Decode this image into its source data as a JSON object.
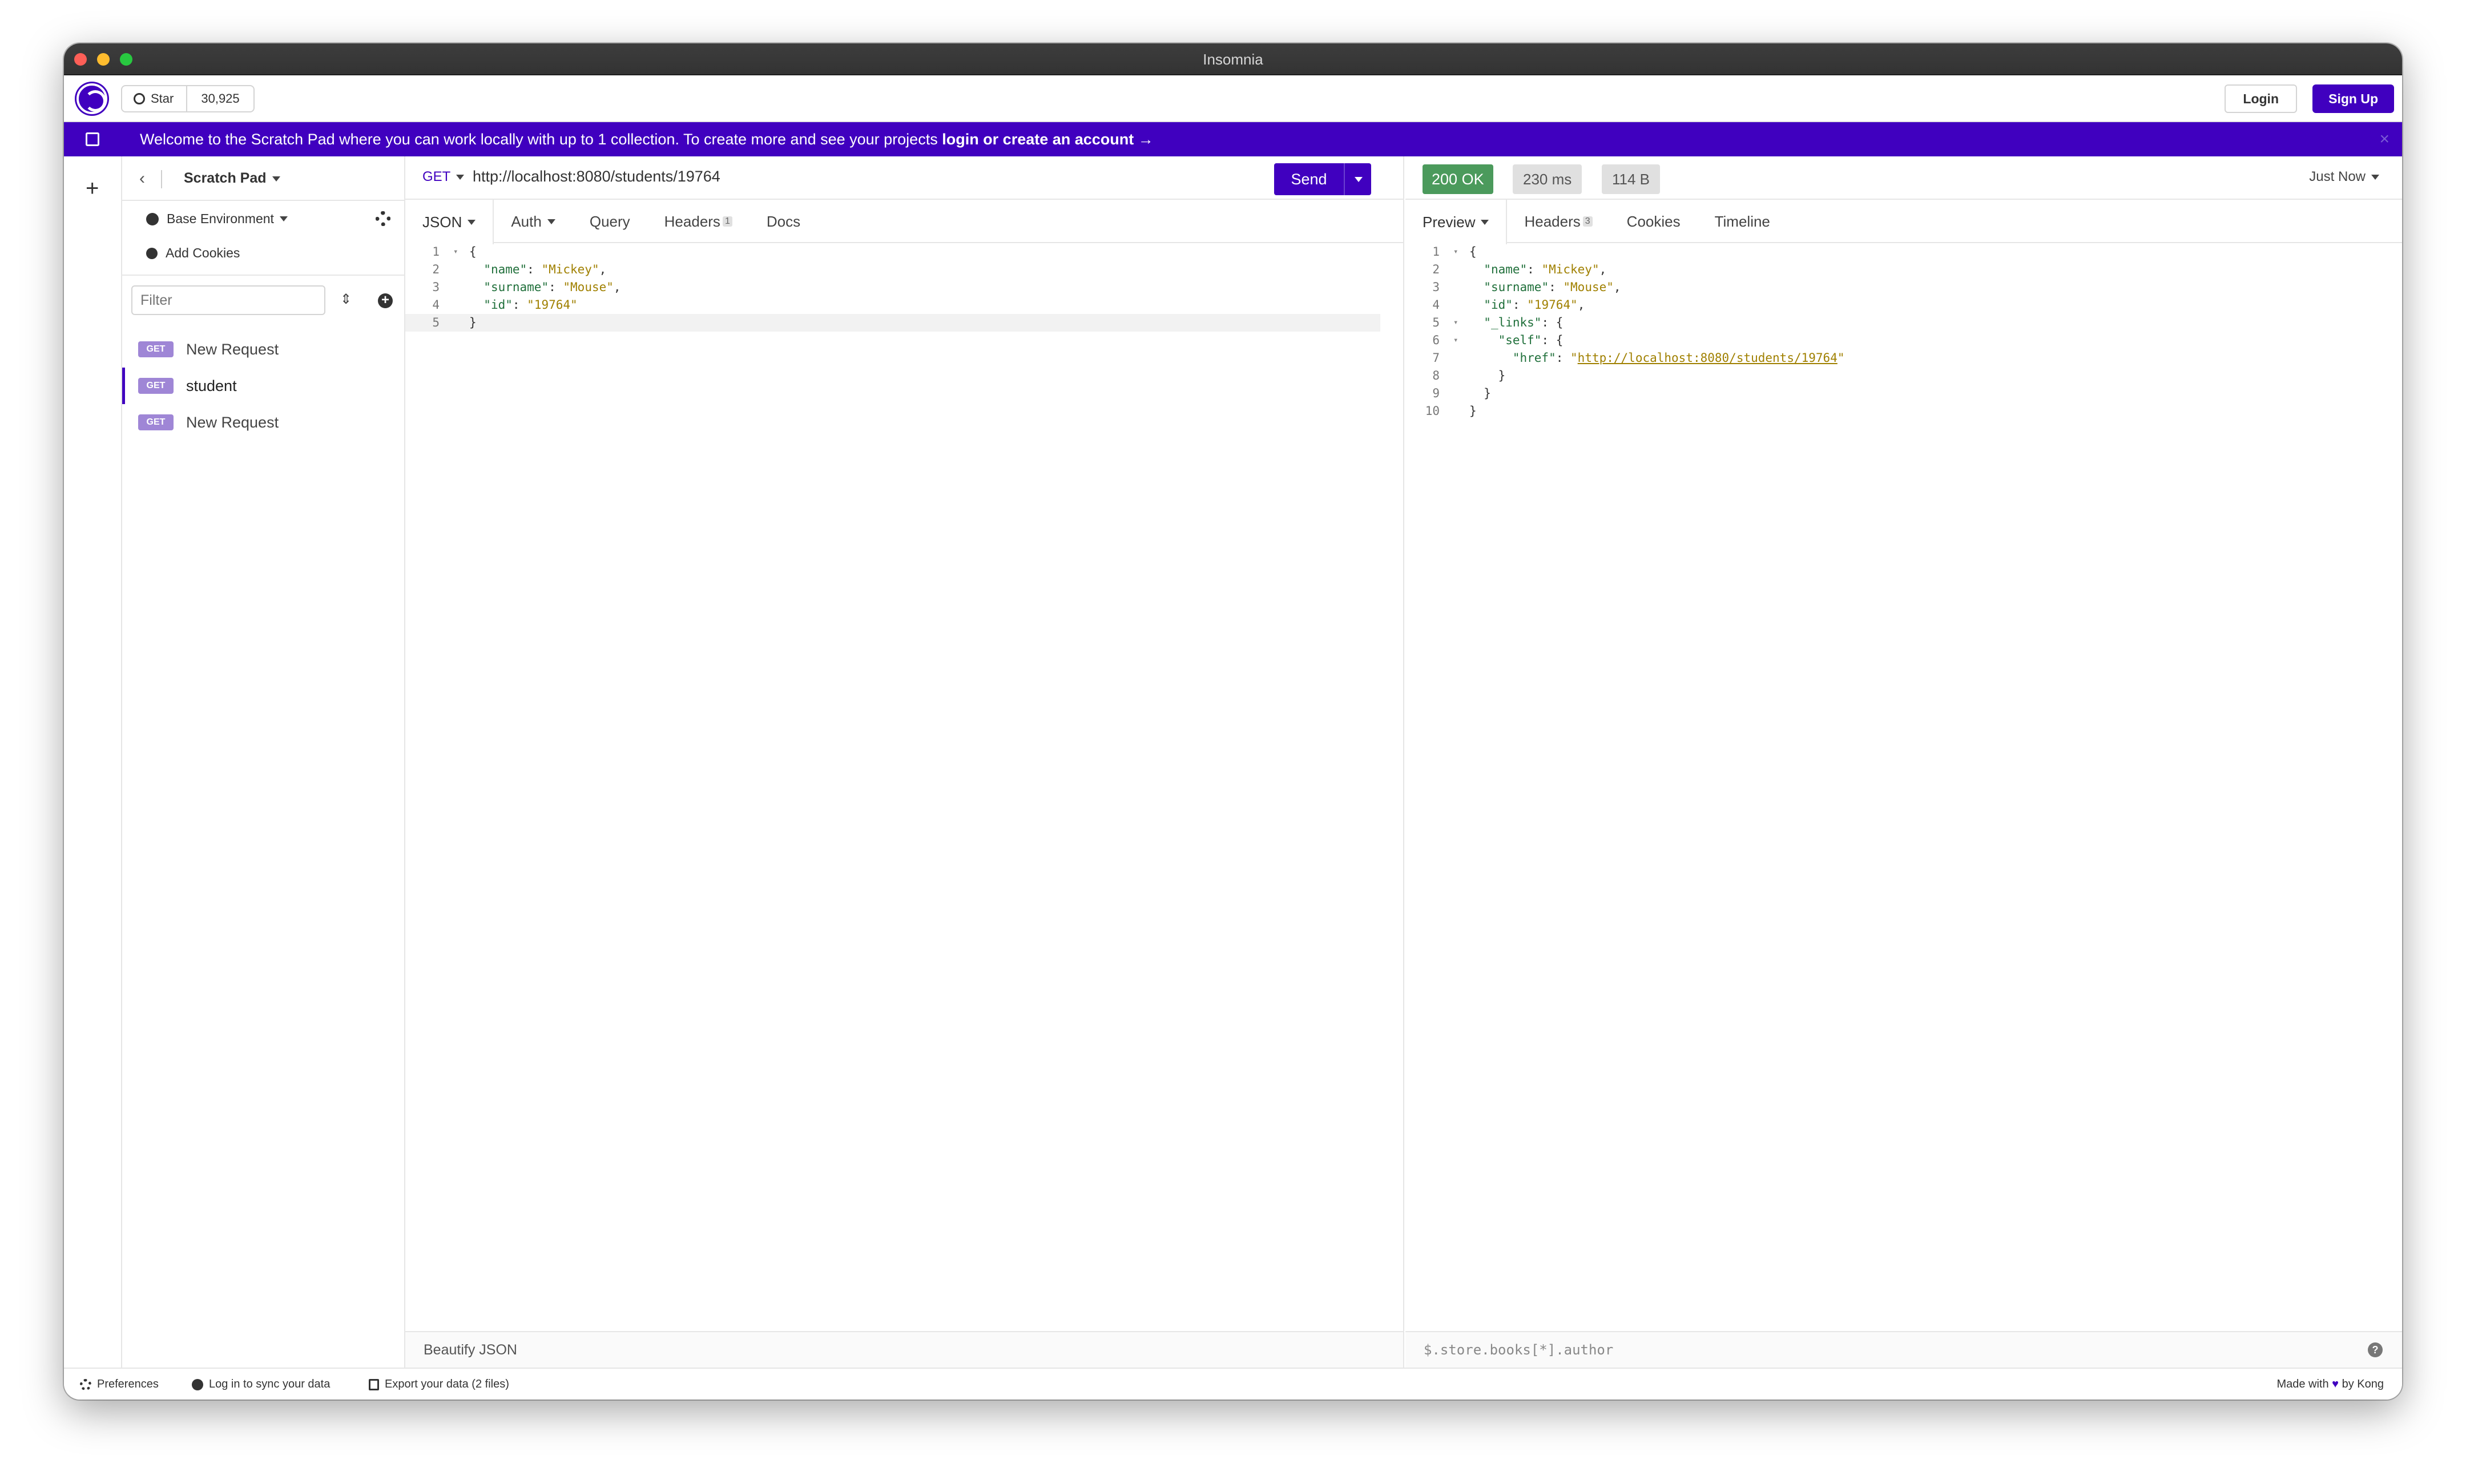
{
  "window": {
    "title": "Insomnia"
  },
  "topbar": {
    "star_label": "Star",
    "star_count": "30,925",
    "login_label": "Login",
    "signup_label": "Sign Up"
  },
  "banner": {
    "text": "Welcome to the Scratch Pad where you can work locally with up to 1 collection. To create more and see your projects ",
    "link": "login or create an account →",
    "close": "×"
  },
  "sidebar": {
    "project": "Scratch Pad",
    "environment": "Base Environment",
    "cookies": "Add Cookies",
    "filter_placeholder": "Filter",
    "requests": [
      {
        "method": "GET",
        "name": "New Request"
      },
      {
        "method": "GET",
        "name": "student"
      },
      {
        "method": "GET",
        "name": "New Request"
      }
    ]
  },
  "request": {
    "method": "GET",
    "url": "http://localhost:8080/students/19764",
    "send_label": "Send",
    "tabs": [
      "JSON",
      "Auth",
      "Query",
      "Headers",
      "Docs"
    ],
    "headers_count": "1",
    "body_lines": [
      {
        "n": "1",
        "fold": true,
        "text": "{"
      },
      {
        "n": "2",
        "key": "\"name\"",
        "val": "\"Mickey\"",
        "end": ","
      },
      {
        "n": "3",
        "key": "\"surname\"",
        "val": "\"Mouse\"",
        "end": ","
      },
      {
        "n": "4",
        "key": "\"id\"",
        "val": "\"19764\"",
        "end": ""
      },
      {
        "n": "5",
        "text": "}"
      }
    ],
    "footer": "Beautify JSON"
  },
  "response": {
    "status_code": "200",
    "status_text": "OK",
    "time": "230 ms",
    "size": "114 B",
    "when": "Just Now",
    "tabs": [
      "Preview",
      "Headers",
      "Cookies",
      "Timeline"
    ],
    "headers_count": "3",
    "body_lines": [
      {
        "n": "1",
        "fold": true,
        "indent": 0,
        "text": "{"
      },
      {
        "n": "2",
        "indent": 1,
        "key": "\"name\"",
        "val": "\"Mickey\"",
        "end": ","
      },
      {
        "n": "3",
        "indent": 1,
        "key": "\"surname\"",
        "val": "\"Mouse\"",
        "end": ","
      },
      {
        "n": "4",
        "indent": 1,
        "key": "\"id\"",
        "val": "\"19764\"",
        "end": ","
      },
      {
        "n": "5",
        "fold": true,
        "indent": 1,
        "key": "\"_links\"",
        "text": "{"
      },
      {
        "n": "6",
        "fold": true,
        "indent": 2,
        "key": "\"self\"",
        "text": "{"
      },
      {
        "n": "7",
        "indent": 3,
        "key": "\"href\"",
        "link": "http://localhost:8080/students/19764"
      },
      {
        "n": "8",
        "indent": 2,
        "text": "}"
      },
      {
        "n": "9",
        "indent": 1,
        "text": "}"
      },
      {
        "n": "10",
        "indent": 0,
        "text": "}"
      }
    ],
    "filter_placeholder": "$.store.books[*].author"
  },
  "statusbar": {
    "preferences": "Preferences",
    "sync": "Log in to sync your data",
    "export": "Export your data (2 files)",
    "made_prefix": "Made with",
    "made_suffix": "by Kong"
  },
  "colors": {
    "accent": "#4000bf",
    "success": "#4b9a5c"
  }
}
